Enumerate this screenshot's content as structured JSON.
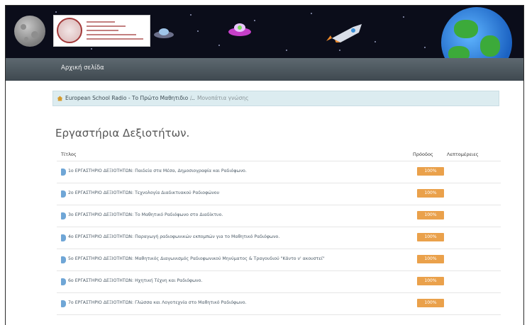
{
  "nav": {
    "home_label": "Αρχική σελίδα"
  },
  "breadcrumb": {
    "items": [
      {
        "label": "European School Radio - Το Πρώτο Μαθητιδιο ..."
      },
      {
        "label": "Μονοπάτια γνώσης"
      }
    ],
    "separator": "/"
  },
  "page": {
    "title": "Εργαστήρια Δεξιοτήτων."
  },
  "table": {
    "headers": {
      "title": "Τίτλος",
      "progress": "Πρόοδος",
      "details": "Λεπτομέρειες"
    },
    "rows": [
      {
        "title": "1ο ΕΡΓΑΣΤΗΡΙΟ ΔΕΞΙΟΤΗΤΩΝ: Παιδεία στα Μέσα, Δημοσιογραφία και Ραδιόφωνο.",
        "progress": "100%"
      },
      {
        "title": "2ο ΕΡΓΑΣΤΗΡΙΟ ΔΕΞΙΟΤΗΤΩΝ: Τεχνολογία Διαδικτυακού Ραδιοφώνου",
        "progress": "100%"
      },
      {
        "title": "3ο ΕΡΓΑΣΤΗΡΙΟ ΔΕΞΙΟΤΗΤΩΝ: Το Μαθητικό Ραδιόφωνο στο Διαδίκτυο.",
        "progress": "100%"
      },
      {
        "title": "4ο ΕΡΓΑΣΤΗΡΙΟ ΔΕΞΙΟΤΗΤΩΝ: Παραγωγή ραδιοφωνικών εκπομπών για το Μαθητικό Ραδιόφωνο.",
        "progress": "100%"
      },
      {
        "title": "5ο ΕΡΓΑΣΤΗΡΙΟ ΔΕΞΙΟΤΗΤΩΝ: Μαθητικός Διαγωνισμός Ραδιοφωνικού Μηνύματος & Τραγουδιού \"Κάντο ν' ακουστεί\"",
        "progress": "100%"
      },
      {
        "title": "6ο ΕΡΓΑΣΤΗΡΙΟ ΔΕΞΙΟΤΗΤΩΝ: Ηχητική Τέχνη και Ραδιόφωνο.",
        "progress": "100%"
      },
      {
        "title": "7ο ΕΡΓΑΣΤΗΡΙΟ ΔΕΞΙΟΤΗΤΩΝ: Γλώσσα και Λογοτεχνία στο Μαθητικό Ραδιόφωνο.",
        "progress": "100%"
      }
    ]
  },
  "icons": {
    "breadcrumb_home": "home-icon",
    "row_item": "bookmark-icon"
  },
  "colors": {
    "progress": "#eaa14b",
    "breadcrumb_bg": "#dcecf0",
    "navbar": "#4b555c"
  }
}
